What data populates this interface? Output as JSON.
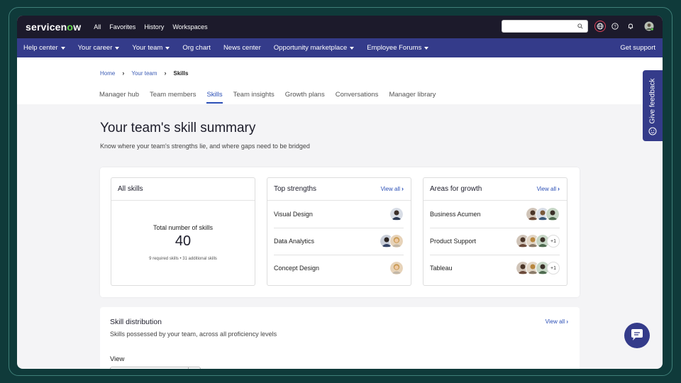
{
  "brand": {
    "name_prefix": "servicen",
    "name_o": "o",
    "name_suffix": "w"
  },
  "topnav": [
    "All",
    "Favorites",
    "History",
    "Workspaces"
  ],
  "search": {
    "placeholder": ""
  },
  "navbar": {
    "items": [
      {
        "label": "Help center",
        "dropdown": true
      },
      {
        "label": "Your career",
        "dropdown": true
      },
      {
        "label": "Your team",
        "dropdown": true
      },
      {
        "label": "Org chart",
        "dropdown": false
      },
      {
        "label": "News center",
        "dropdown": false
      },
      {
        "label": "Opportunity marketplace",
        "dropdown": true
      },
      {
        "label": "Employee Forums",
        "dropdown": true
      }
    ],
    "support": "Get support"
  },
  "breadcrumb": [
    "Home",
    "Your team",
    "Skills"
  ],
  "tabs": [
    "Manager hub",
    "Team members",
    "Skills",
    "Team insights",
    "Growth plans",
    "Conversations",
    "Manager library"
  ],
  "active_tab": "Skills",
  "page": {
    "title": "Your team's skill summary",
    "subtitle": "Know where your team's strengths lie, and where gaps need to be bridged"
  },
  "all_skills": {
    "title": "All skills",
    "label": "Total number of skills",
    "total": "40",
    "sub": "9 required skills • 31 additional skills"
  },
  "top_strengths": {
    "title": "Top strengths",
    "view_all": "View all",
    "rows": [
      {
        "skill": "Visual Design",
        "avatars": 1,
        "more": ""
      },
      {
        "skill": "Data Analytics",
        "avatars": 2,
        "more": ""
      },
      {
        "skill": "Concept Design",
        "avatars": 1,
        "more": ""
      }
    ]
  },
  "areas_growth": {
    "title": "Areas for growth",
    "view_all": "View all",
    "rows": [
      {
        "skill": "Business Acumen",
        "avatars": 3,
        "more": ""
      },
      {
        "skill": "Product Support",
        "avatars": 3,
        "more": "+1"
      },
      {
        "skill": "Tableau",
        "avatars": 3,
        "more": "+1"
      }
    ]
  },
  "skill_distribution": {
    "title": "Skill distribution",
    "subtitle": "Skills possessed by your team, across all proficiency levels",
    "view_all": "View all",
    "view_label": "View"
  },
  "feedback": {
    "label": "Give feedback"
  },
  "colors": {
    "navbar": "#343b8a",
    "topbar": "#1c1a2b",
    "link": "#2b4fb6",
    "accent_green": "#62d84e"
  }
}
